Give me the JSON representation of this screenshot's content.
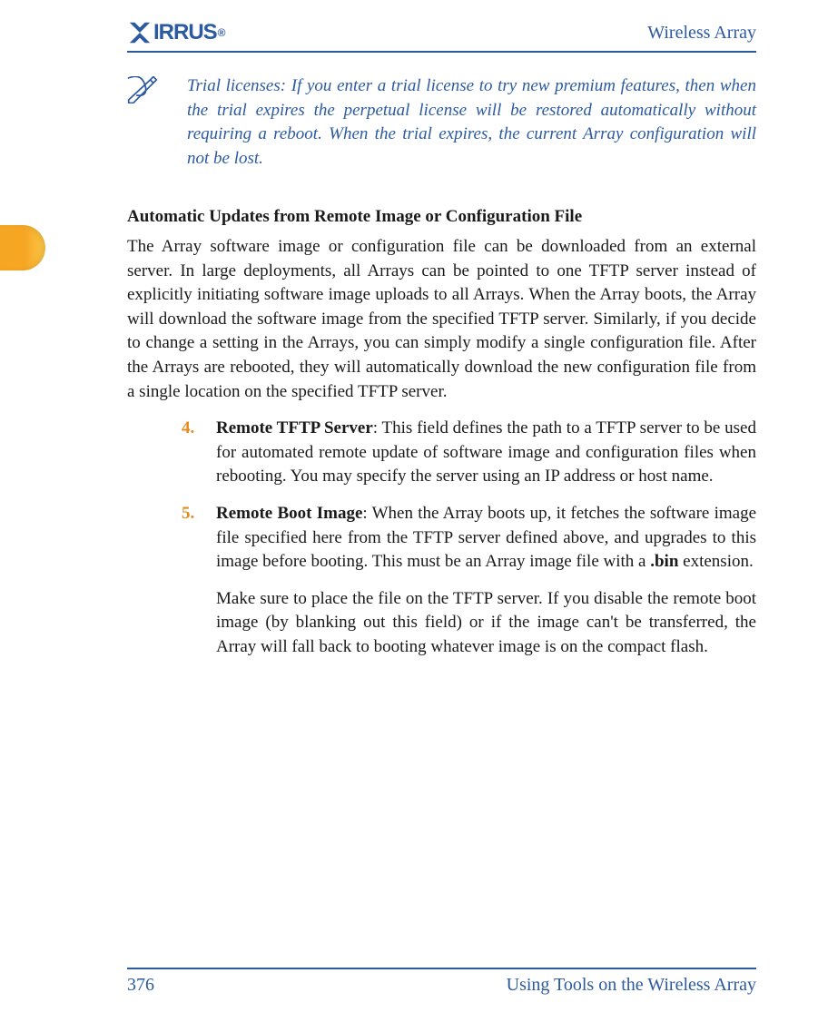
{
  "header": {
    "brand": "XIRRUS",
    "title": "Wireless Array"
  },
  "note": {
    "text": "Trial licenses: If you enter a trial license to try new premium features, then when the trial expires the perpetual license will be restored automatically without requiring a reboot. When the trial expires, the current Array configuration will not be lost."
  },
  "section": {
    "heading": "Automatic Updates from Remote Image or Configuration File",
    "paragraph": "The Array software image or configuration file can be downloaded from an external server. In large deployments, all Arrays can be pointed to one TFTP server instead of explicitly initiating software image uploads to all Arrays. When the Array boots, the Array will download the software image from the specified TFTP server. Similarly, if you decide to change a setting in the Arrays, you can simply modify a single configuration file. After the Arrays are rebooted, they will automatically download the new configuration file from a single location on the specified TFTP server."
  },
  "items": [
    {
      "num": "4.",
      "title": "Remote TFTP Server",
      "body": ": This field defines the path to a TFTP server to be used for automated remote update of software image and configuration files when rebooting. You may specify the server using an IP address or host name."
    },
    {
      "num": "5.",
      "title": "Remote Boot Image",
      "body_pre": ": When the Array boots up, it fetches the software image file specified here from the TFTP server defined above, and upgrades to this image before booting. This must be an Array image file with a ",
      "body_bold": ".bin",
      "body_post": " extension.",
      "continue": "Make sure to place the file on the TFTP server. If you disable the remote boot image (by blanking out this field) or if the image can't be transferred, the Array will fall back to booting whatever image is on the compact flash."
    }
  ],
  "footer": {
    "page": "376",
    "section": "Using Tools on the Wireless Array"
  }
}
